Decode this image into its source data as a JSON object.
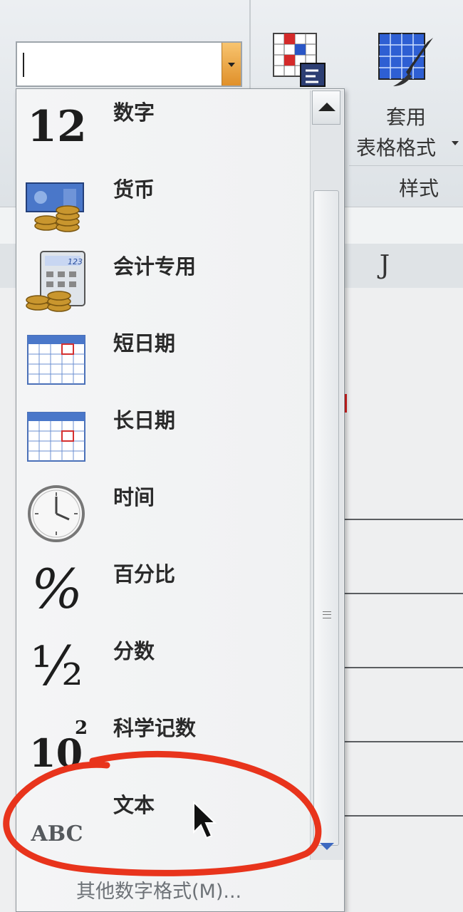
{
  "ribbon": {
    "number_format_value": "",
    "table_style_line1": "套用",
    "table_style_line2": "表格格式",
    "styles_group_label": "样式"
  },
  "sheet": {
    "column_header": "J"
  },
  "number_formats": [
    {
      "label": "数字",
      "icon": "number-12-icon",
      "glyph": "12"
    },
    {
      "label": "货币",
      "icon": "currency-icon"
    },
    {
      "label": "会计专用",
      "icon": "accounting-icon",
      "glyph_small": "123"
    },
    {
      "label": "短日期",
      "icon": "short-date-calendar-icon"
    },
    {
      "label": "长日期",
      "icon": "long-date-calendar-icon"
    },
    {
      "label": "时间",
      "icon": "clock-icon"
    },
    {
      "label": "百分比",
      "icon": "percent-icon",
      "glyph": "%"
    },
    {
      "label": "分数",
      "icon": "fraction-icon",
      "glyph": "½"
    },
    {
      "label": "科学记数",
      "icon": "scientific-icon",
      "glyph": "10",
      "glyph_sup": "2"
    },
    {
      "label": "文本",
      "icon": "text-abc-icon",
      "glyph": "ABC"
    }
  ],
  "more_formats_label": "其他数字格式(M)...",
  "colors": {
    "annotation_red": "#e8341c",
    "dropdown_arrow_orange": "#f0a040"
  }
}
